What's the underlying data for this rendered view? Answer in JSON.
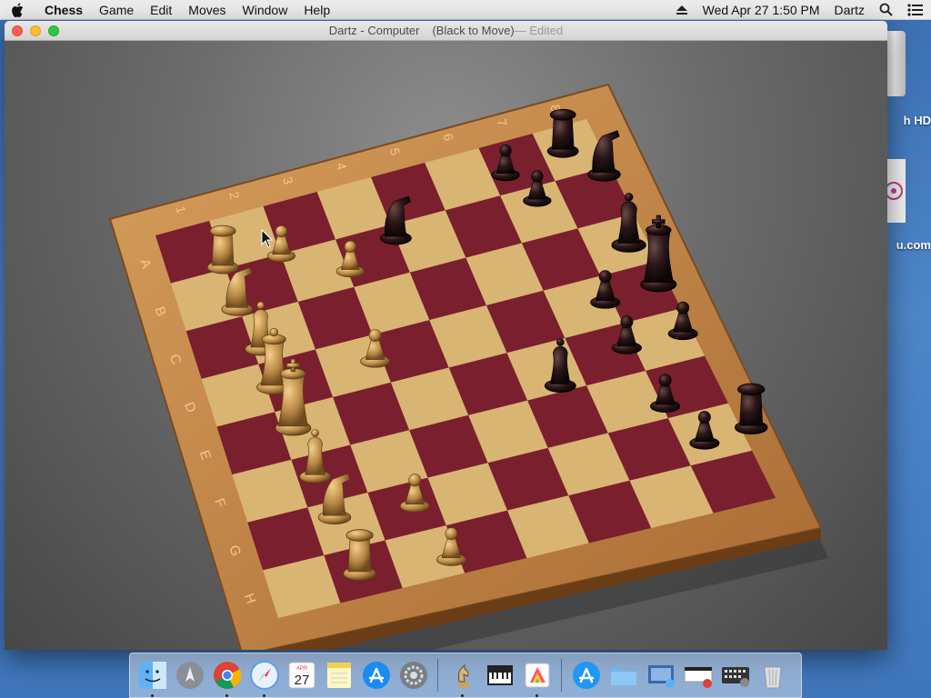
{
  "menubar": {
    "app_name": "Chess",
    "items": [
      "Game",
      "Edit",
      "Moves",
      "Window",
      "Help"
    ],
    "clock": "Wed Apr 27  1:50 PM",
    "user": "Dartz"
  },
  "desktop": {
    "hd_label": "h HD",
    "web_label": "u.com"
  },
  "window": {
    "title": "Dartz - Computer",
    "state": "(Black to Move)",
    "edited": "— Edited"
  },
  "board": {
    "light_square": "#d9b574",
    "dark_square": "#7a1f2e",
    "frame": "#c28a4a",
    "white_piece": "#c99a55",
    "black_piece": "#2a1616",
    "rank_labels": [
      "A",
      "B",
      "C",
      "D",
      "E",
      "F",
      "G",
      "H"
    ],
    "file_labels": [
      "1",
      "2",
      "3",
      "4",
      "5",
      "6",
      "7",
      "8"
    ]
  },
  "dock": {
    "items": [
      {
        "name": "finder",
        "icon": "finder-icon"
      },
      {
        "name": "launchpad",
        "icon": "launchpad-icon"
      },
      {
        "name": "chrome",
        "icon": "chrome-icon"
      },
      {
        "name": "safari",
        "icon": "safari-icon"
      },
      {
        "name": "calendar",
        "icon": "calendar-icon",
        "month": "APR",
        "day": "27"
      },
      {
        "name": "notes",
        "icon": "notes-icon"
      },
      {
        "name": "app-store",
        "icon": "app-store-icon"
      },
      {
        "name": "system-preferences",
        "icon": "system-preferences-icon"
      },
      {
        "name": "chess",
        "icon": "chess-icon"
      },
      {
        "name": "piano",
        "icon": "piano-icon"
      },
      {
        "name": "color-picker",
        "icon": "color-picker-icon"
      },
      {
        "name": "applications",
        "icon": "applications-folder-icon"
      },
      {
        "name": "folder",
        "icon": "folder-icon"
      },
      {
        "name": "screenshots",
        "icon": "screenshots-icon"
      },
      {
        "name": "downloads",
        "icon": "downloads-icon"
      },
      {
        "name": "keyboard",
        "icon": "keyboard-viewer-icon"
      },
      {
        "name": "trash",
        "icon": "trash-icon"
      }
    ]
  }
}
